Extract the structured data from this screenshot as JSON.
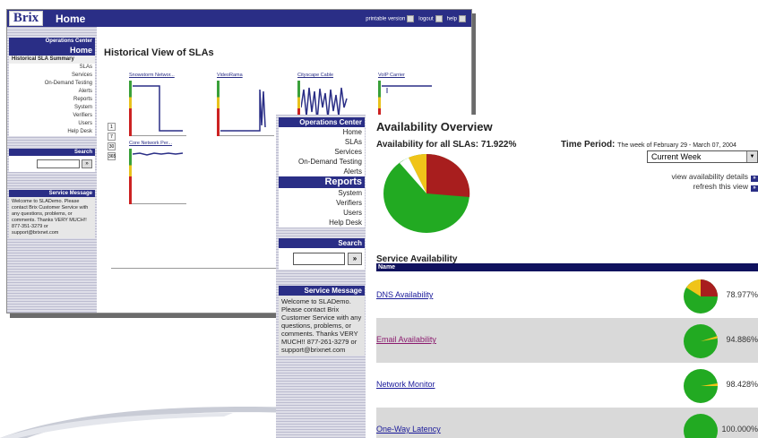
{
  "back": {
    "logo": "Brix",
    "title": "Home",
    "toplinks": {
      "printable": "printable version",
      "logout": "logout",
      "help": "help"
    },
    "ops_head": "Operations Center",
    "menu": [
      "Home",
      "Historical SLA Summary",
      "SLAs",
      "Services",
      "On-Demand Testing",
      "Alerts",
      "Reports",
      "System",
      "Verifiers",
      "Users",
      "Help Desk"
    ],
    "search_head": "Search",
    "search_btn": "»",
    "msg_head": "Service Message",
    "msg_text": "Welcome to SLADemo. Please contact Brix Customer Service with any questions, problems, or comments. Thanks VERY MUCH!! 877-351-3279 or support@brixnet.com",
    "page_title": "Historical View of SLAs",
    "charts": [
      "Snowstorm Networ...",
      "VideoRama",
      "Cityscape Cable",
      "VoIP Carrier",
      "Core Network Per..."
    ],
    "ranges": [
      "1",
      "7",
      "30",
      "365"
    ]
  },
  "front": {
    "ops_head": "Operations Center",
    "menu": [
      "Home",
      "SLAs",
      "Services",
      "On-Demand Testing",
      "Alerts",
      "Reports",
      "System",
      "Verifiers",
      "Users",
      "Help Desk"
    ],
    "search_head": "Search",
    "search_btn": "»",
    "msg_head": "Service Message",
    "msg_text": "Welcome to SLADemo. Please contact Brix Customer Service with any questions, problems, or comments. Thanks VERY MUCH!! 877-261-3279 or support@brixnet.com",
    "title": "Availability Overview",
    "avail_all": "Availability for all SLAs: 71.922%",
    "tp_label": "Time Period:",
    "tp_range": "The week of February 29 - March 07, 2004",
    "tp_select": "Current Week",
    "link_details": "view availability details",
    "link_refresh": "refresh this view",
    "sa_title": "Service Availability",
    "sa_head": "Name",
    "rows": [
      {
        "name": "DNS Availability",
        "pct": "78.977%"
      },
      {
        "name": "Email Availability",
        "pct": "94.886%"
      },
      {
        "name": "Network Monitor",
        "pct": "98.428%"
      },
      {
        "name": "One-Way Latency",
        "pct": "100.000%"
      }
    ],
    "colors": {
      "green": "#22aa22",
      "yellow": "#f0c419",
      "red": "#a81e1e",
      "navy": "#2a2e86"
    }
  }
}
